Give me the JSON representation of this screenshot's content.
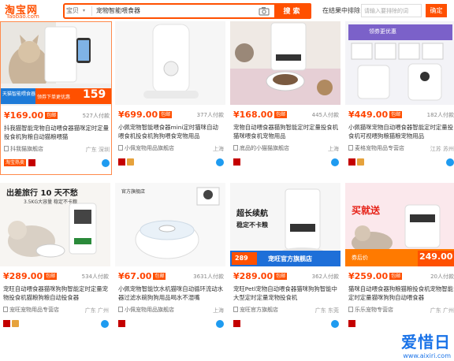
{
  "header": {
    "logo_cn": "淘宝网",
    "logo_en": "Taobao.com",
    "search_scope": "宝贝",
    "search_query": "宠物智能喂食器",
    "search_button": "搜索",
    "refine_label": "在结果中排除",
    "refine_placeholder": "请输入要排除的词",
    "refine_button": "确定"
  },
  "products": [
    {
      "price": "¥169.00",
      "baoyou": "包邮",
      "sold": "527人付款",
      "title": "抖我猫智能宠物自动喂食器猫咪定时定量投食机狗粮自动猫粮喂猫",
      "shop": "抖我猫旗舰店",
      "location": "广东 深圳",
      "promo": "淘宝热卖",
      "overlay_left": "天猫智能喂食器",
      "overlay_sub": "领券下单更优惠",
      "overlay_price": "159"
    },
    {
      "price": "¥699.00",
      "baoyou": "包邮",
      "sold": "377人付款",
      "title": "小佩宠物智能喂食器mini定时猫咪自动喂食机投食机狗狗喂食宠物用品",
      "shop": "小佩宠物用品旗舰店",
      "location": "上海"
    },
    {
      "price": "¥168.00",
      "baoyou": "包邮",
      "sold": "445人付款",
      "title": "宠物自动喂食器猫狗智能定时定量投食机猫咪喂食机宠物用品",
      "shop": "底品的小猫猫旗舰店",
      "location": "上海"
    },
    {
      "price": "¥449.00",
      "baoyou": "包邮",
      "sold": "182人付款",
      "title": "小佩猫咪宠物自动喂食器智能定时定量投食机可视喂狗粮猫粮宠物用品",
      "shop": "麦格宠物用品专营店",
      "location": "江苏 苏州",
      "overlay_left": "领券更优惠"
    },
    {
      "price": "¥289.00",
      "baoyou": "包邮",
      "sold": "534人付款",
      "title": "宠旺自动喂食器猫咪狗狗智能定时定量宠物投食机猫粮狗粮自动投食器",
      "shop": "宠旺宠物用品专营店",
      "location": "广东 广州",
      "overlay_left": "出差旅行 10 天不愁",
      "overlay_sub": "3.5KG大容量 稳定不卡粮"
    },
    {
      "price": "¥67.00",
      "baoyou": "包邮",
      "sold": "3631人付款",
      "title": "小佩宠物智能饮水机猫咪自动循环流动水器过滤水碗狗狗用品喝水不湿嘴",
      "shop": "小佩宠物用品旗舰店",
      "location": "上海",
      "overlay_left": "官方旗舰店"
    },
    {
      "price": "¥289.00",
      "baoyou": "包邮",
      "sold": "362人付款",
      "title": "宠旺Petl宠物自动喂食器猫咪狗狗智能中大型定时定量宠物投食机",
      "shop": "宠旺官方旗舰店",
      "location": "广东 东莞",
      "overlay_left": "超长续航",
      "overlay_sub": "稳定不卡粮",
      "overlay_price": "289",
      "overlay_caption": "宠旺官方旗舰店"
    },
    {
      "price": "¥259.00",
      "baoyou": "包邮",
      "sold": "20人付款",
      "title": "猫咪自动喂食器狗粮猫粮投食机宠物智能定时定量猫咪狗狗自动喂食器",
      "shop": "乐乐宠物专营店",
      "location": "广东 广州",
      "overlay_left": "买就送",
      "overlay_sub": "券后价",
      "overlay_price": "249.00"
    }
  ],
  "watermark": {
    "brand": "爱惜日",
    "url": "www.aixiri.com"
  },
  "colors": {
    "accent": "#ff5000",
    "price": "#ff4400",
    "watermark": "#1a73e8"
  }
}
